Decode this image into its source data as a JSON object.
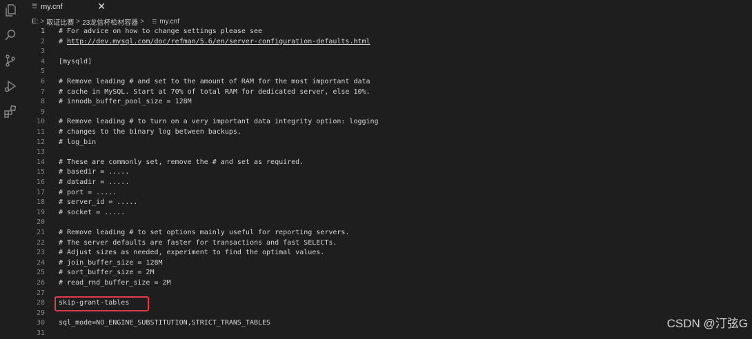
{
  "tab": {
    "label": "my.cnf",
    "icon": "file-lines-icon",
    "close": "✕"
  },
  "breadcrumb": {
    "parts": [
      "E:",
      "取证比赛",
      "23龙信杯检材容器"
    ],
    "file": "my.cnf"
  },
  "activity_icons": [
    "files-icon",
    "search-icon",
    "source-control-icon",
    "run-debug-icon",
    "extensions-icon"
  ],
  "lines": [
    {
      "n": "1",
      "t": "# For advice on how to change settings please see"
    },
    {
      "n": "2",
      "t": "# ",
      "url": "http://dev.mysql.com/doc/refman/5.6/en/server-configuration-defaults.html"
    },
    {
      "n": "3",
      "t": ""
    },
    {
      "n": "4",
      "t": "[mysqld]"
    },
    {
      "n": "5",
      "t": ""
    },
    {
      "n": "6",
      "t": "# Remove leading # and set to the amount of RAM for the most important data"
    },
    {
      "n": "7",
      "t": "# cache in MySQL. Start at 70% of total RAM for dedicated server, else 10%."
    },
    {
      "n": "8",
      "t": "# innodb_buffer_pool_size = 128M"
    },
    {
      "n": "9",
      "t": ""
    },
    {
      "n": "10",
      "t": "# Remove leading # to turn on a very important data integrity option: logging"
    },
    {
      "n": "11",
      "t": "# changes to the binary log between backups."
    },
    {
      "n": "12",
      "t": "# log_bin"
    },
    {
      "n": "13",
      "t": ""
    },
    {
      "n": "14",
      "t": "# These are commonly set, remove the # and set as required."
    },
    {
      "n": "15",
      "t": "# basedir = ....."
    },
    {
      "n": "16",
      "t": "# datadir = ....."
    },
    {
      "n": "17",
      "t": "# port = ....."
    },
    {
      "n": "18",
      "t": "# server_id = ....."
    },
    {
      "n": "19",
      "t": "# socket = ....."
    },
    {
      "n": "20",
      "t": ""
    },
    {
      "n": "21",
      "t": "# Remove leading # to set options mainly useful for reporting servers."
    },
    {
      "n": "22",
      "t": "# The server defaults are faster for transactions and fast SELECTs."
    },
    {
      "n": "23",
      "t": "# Adjust sizes as needed, experiment to find the optimal values."
    },
    {
      "n": "24",
      "t": "# join_buffer_size = 128M"
    },
    {
      "n": "25",
      "t": "# sort_buffer_size = 2M"
    },
    {
      "n": "26",
      "t": "# read_rnd_buffer_size = 2M"
    },
    {
      "n": "27",
      "t": ""
    },
    {
      "n": "28",
      "t": "skip-grant-tables"
    },
    {
      "n": "29",
      "t": ""
    },
    {
      "n": "30",
      "t": "sql_mode=NO_ENGINE_SUBSTITUTION,STRICT_TRANS_TABLES"
    },
    {
      "n": "31",
      "t": ""
    }
  ],
  "watermark": "CSDN @汀弦G",
  "colors": {
    "background": "#1e1e1e",
    "text": "#d4d4d4",
    "line_number": "#858585",
    "highlight_box": "#e23a4b"
  }
}
